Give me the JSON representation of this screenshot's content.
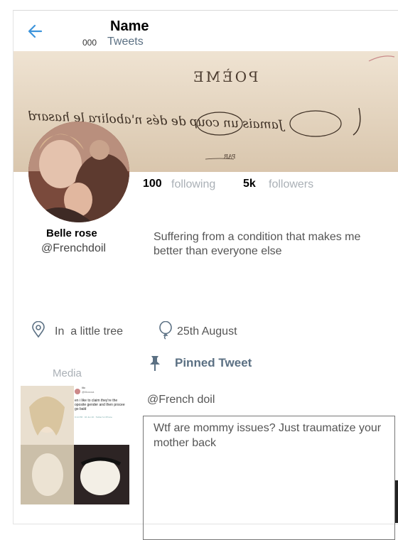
{
  "header": {
    "name": "Name",
    "tweet_count": "000",
    "tweets_label": "Tweets"
  },
  "banner": {
    "title_text": "POÈME",
    "script_text": "Jamais un coup de dés n'abolira le hasard",
    "small_text": "PAR"
  },
  "stats": {
    "following_count": "100",
    "following_label": "following",
    "followers_count": "5k",
    "followers_label": "followers"
  },
  "profile": {
    "display_name": "Belle rose",
    "handle": "@Frenchdoil",
    "bio": "Suffering from a condition that makes me better than everyone else",
    "location": "In  a little tree",
    "birthday": "25th August"
  },
  "media": {
    "label": "Media",
    "screenshot_name": "lilo",
    "screenshot_handle": "@lilcocoa",
    "screenshot_text": "en i like to claim they're the oposite gender and then procee go bald",
    "screenshot_time": "9:14 PM · 04 Jun 20 · Twitter for iPhone"
  },
  "pinned": {
    "label": "Pinned Tweet",
    "author": "@French doil",
    "text": "Wtf are mommy issues? Just traumatize your mother back"
  },
  "colors": {
    "accent": "#1da1f2",
    "muted": "#aab0b6",
    "slate": "#5b7083"
  },
  "icons": {
    "back": "arrow-left-icon",
    "location": "map-pin-icon",
    "birthday": "balloon-icon",
    "pin": "pushpin-icon"
  }
}
